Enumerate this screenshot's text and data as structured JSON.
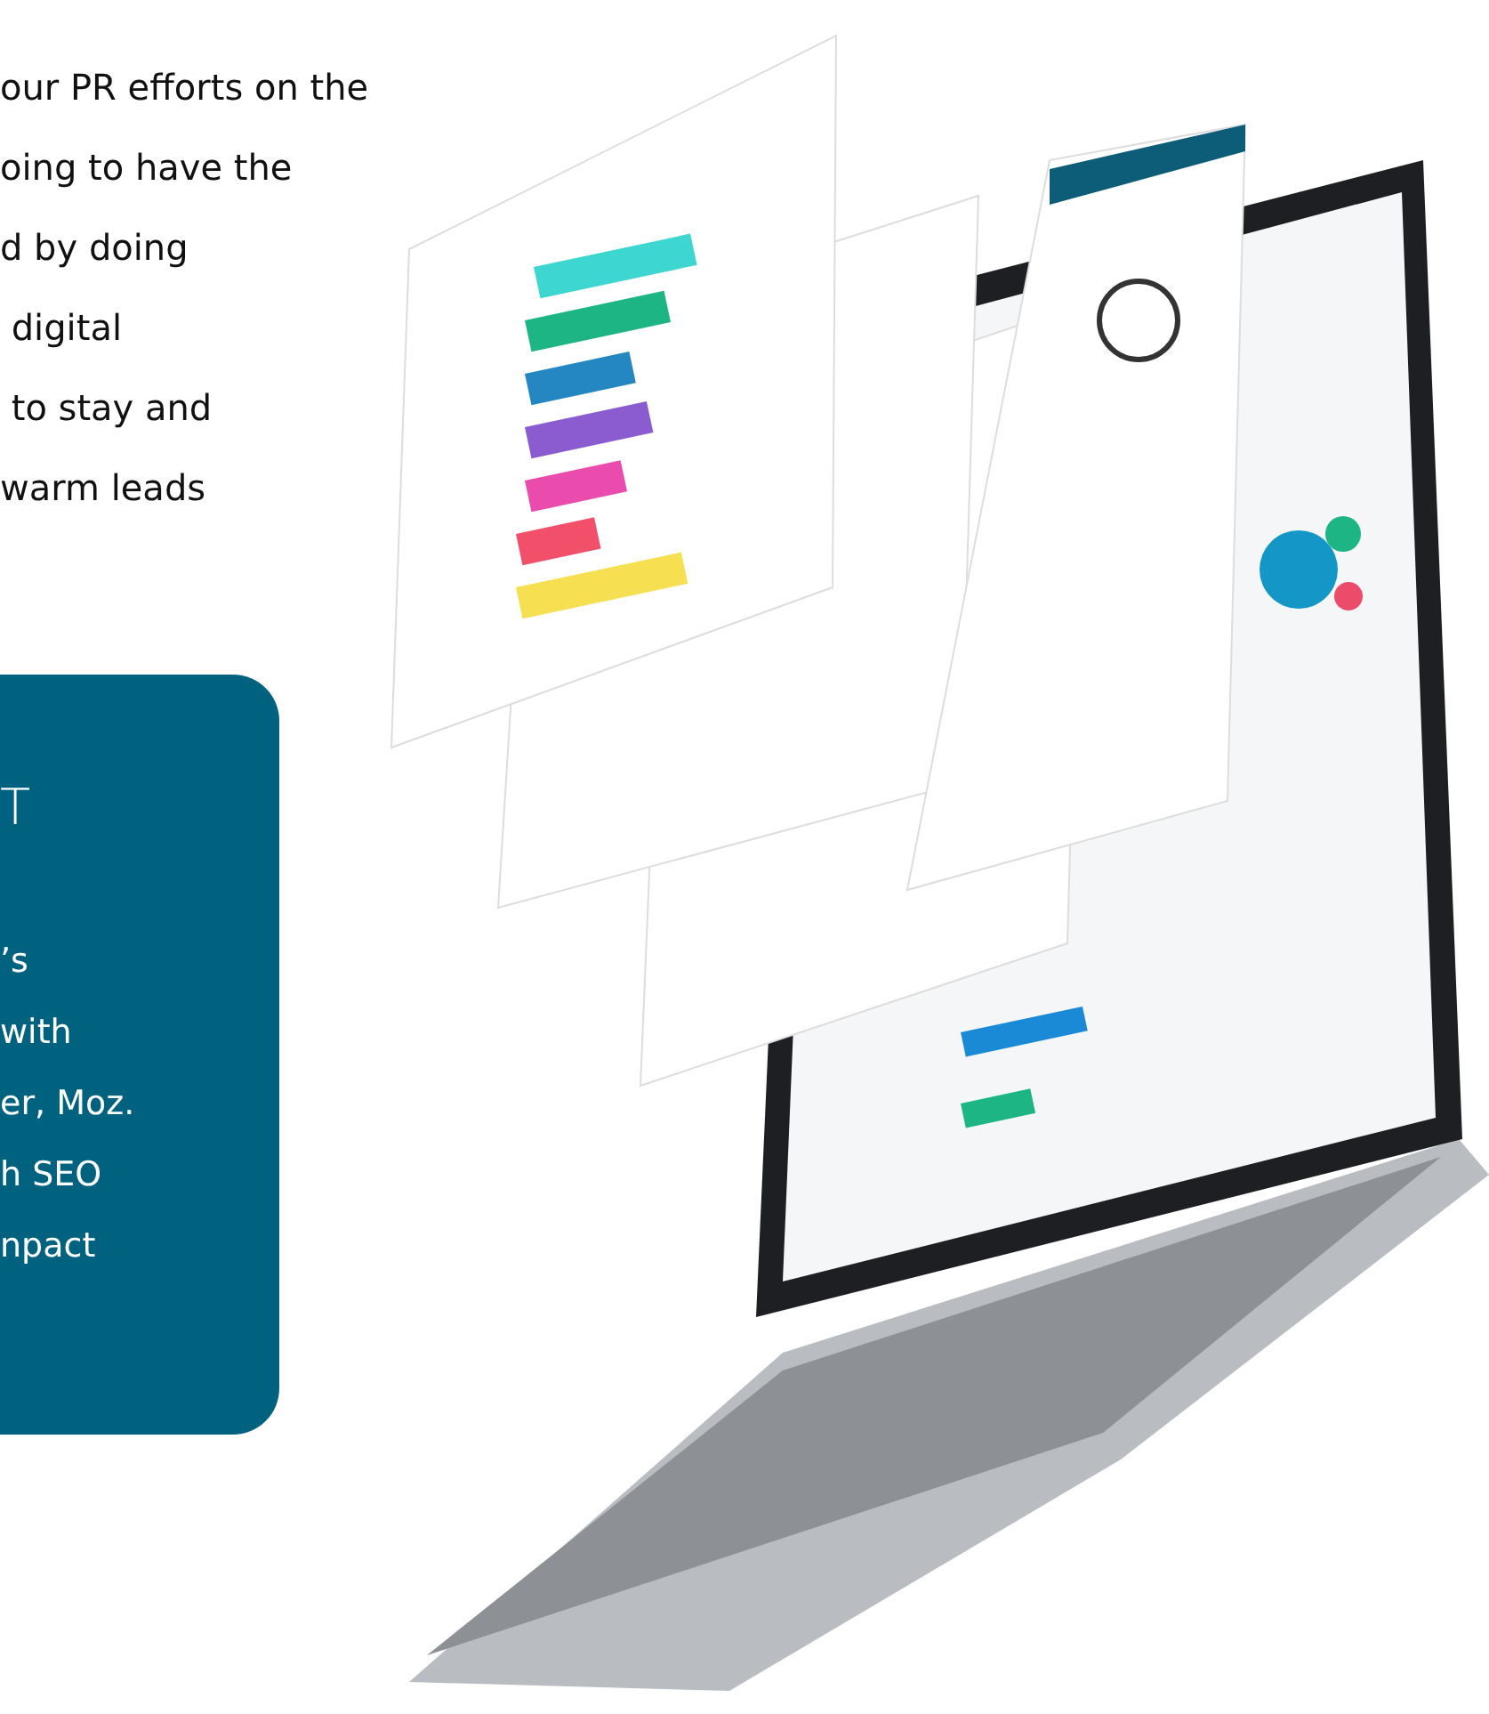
{
  "intro": {
    "lines": [
      "our PR efforts on the",
      "oing to have the",
      "d by doing",
      " digital",
      " to stay and",
      "warm leads"
    ]
  },
  "card": {
    "heading": "T",
    "lines": [
      "’s",
      "with",
      "er, Moz.",
      "h SEO",
      "npact"
    ]
  }
}
